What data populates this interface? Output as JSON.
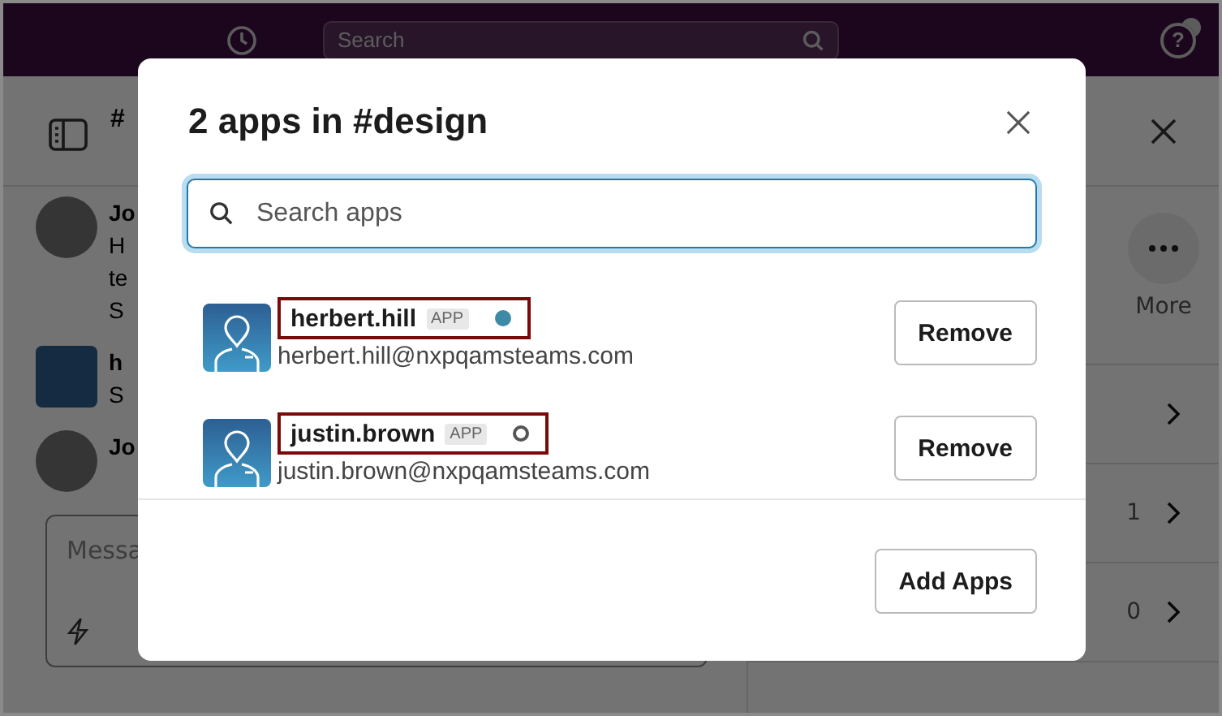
{
  "top_bar": {
    "search_placeholder": "Search",
    "help_glyph": "?"
  },
  "channel_header": {
    "title": "#"
  },
  "messages": [
    {
      "kind": "photo",
      "author": "Jo",
      "lines": [
        "H",
        "te",
        "S"
      ]
    },
    {
      "kind": "app",
      "author": "h",
      "lines": [
        "S"
      ]
    },
    {
      "kind": "photo",
      "author": "Jo"
    }
  ],
  "composer": {
    "placeholder": "Messa"
  },
  "details_panel": {
    "more_label": "More",
    "rows": [
      {
        "kind": "link"
      },
      {
        "kind": "link",
        "count": "1"
      },
      {
        "kind": "link",
        "count": "0"
      }
    ]
  },
  "modal": {
    "title": "2 apps in #design",
    "search": {
      "placeholder": "Search apps"
    },
    "apps": [
      {
        "name": "herbert.hill",
        "badge": "APP",
        "active": true,
        "email": "herbert.hill@nxpqamsteams.com",
        "action": "Remove"
      },
      {
        "name": "justin.brown",
        "badge": "APP",
        "active": false,
        "email": "justin.brown@nxpqamsteams.com",
        "action": "Remove"
      }
    ],
    "footer_button": "Add Apps"
  }
}
